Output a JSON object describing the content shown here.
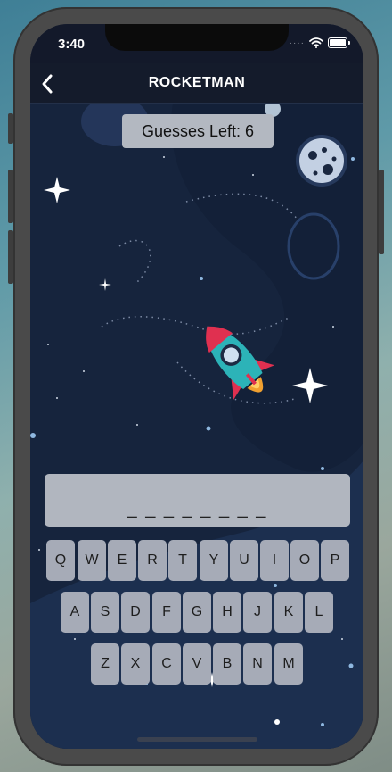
{
  "status_bar": {
    "time": "3:40",
    "signal_dots": "····"
  },
  "nav": {
    "title": "ROCKETMAN",
    "back_icon": "chevron-left-icon"
  },
  "game": {
    "guesses_left": "Guesses Left: 6",
    "word_display": "_ _ _ _ _ _ _ _"
  },
  "keyboard": {
    "row1": [
      "Q",
      "W",
      "E",
      "R",
      "T",
      "Y",
      "U",
      "I",
      "O",
      "P"
    ],
    "row2": [
      "A",
      "S",
      "D",
      "F",
      "G",
      "H",
      "J",
      "K",
      "L"
    ],
    "row3": [
      "Z",
      "X",
      "C",
      "V",
      "B",
      "N",
      "M"
    ]
  },
  "colors": {
    "background": "#16243d",
    "nav_bar": "#141b2b",
    "key": "#a6abb7",
    "rocket_body": "#2cb3b8",
    "rocket_fins": "#e03050",
    "flame": "#f0a030"
  }
}
